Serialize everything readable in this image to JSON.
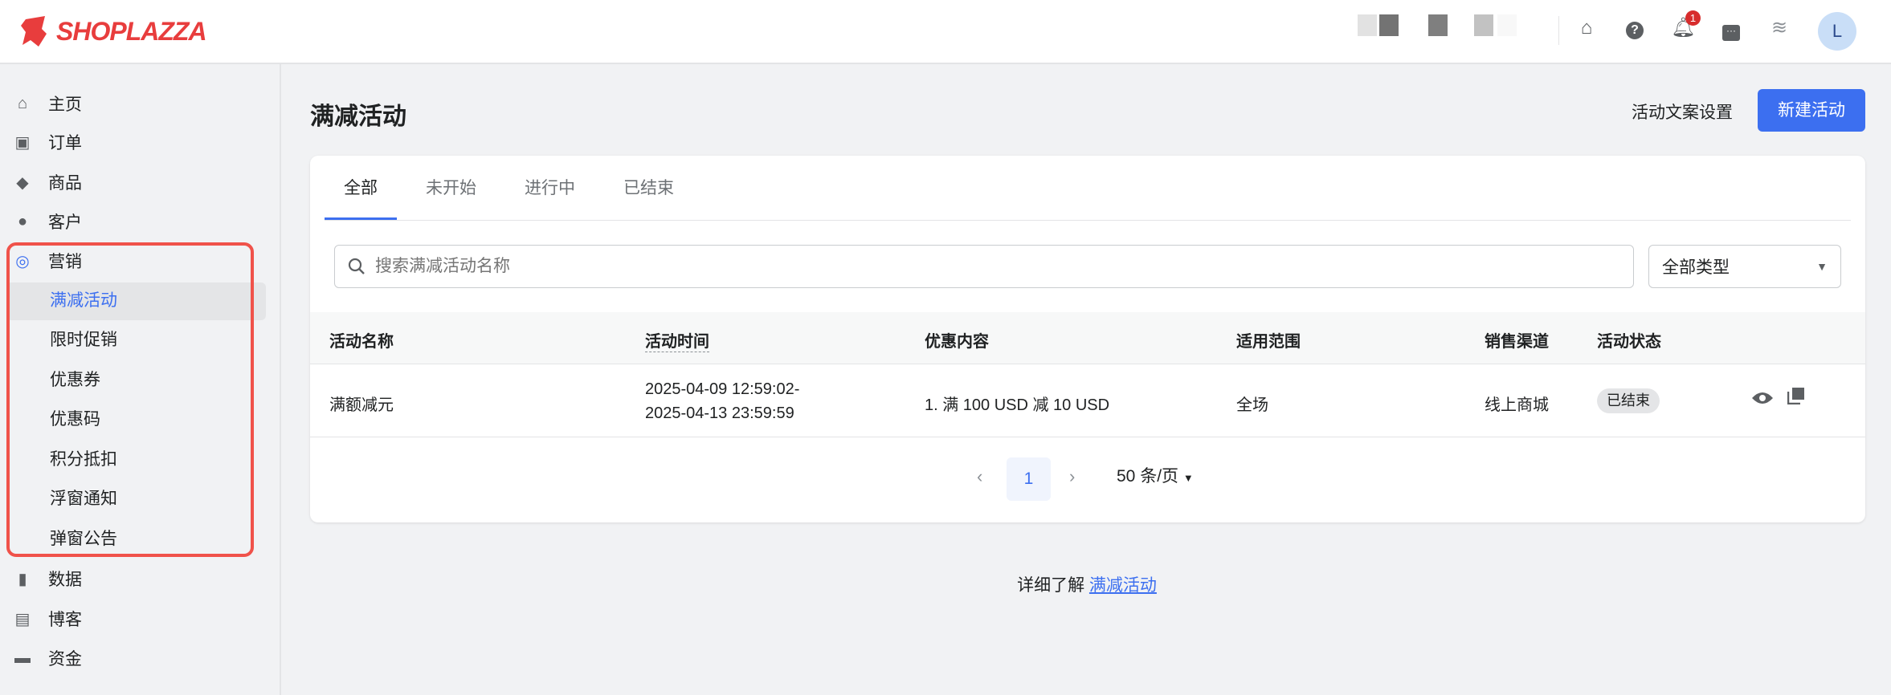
{
  "brand": {
    "name": "SHOPLAZZA",
    "color": "#e83d3d"
  },
  "topbar": {
    "notification_count": "1",
    "avatar_initial": "L",
    "icons": [
      "store-icon",
      "help-icon",
      "bell-icon",
      "chat-icon",
      "wifi-icon"
    ]
  },
  "sidebar": {
    "items": [
      {
        "label": "主页",
        "icon": "home-icon"
      },
      {
        "label": "订单",
        "icon": "inbox-icon"
      },
      {
        "label": "商品",
        "icon": "tag-icon"
      },
      {
        "label": "客户",
        "icon": "person-icon"
      },
      {
        "label": "营销",
        "icon": "marketing-icon"
      },
      {
        "label": "数据",
        "icon": "chart-icon"
      },
      {
        "label": "博客",
        "icon": "blog-icon"
      },
      {
        "label": "资金",
        "icon": "wallet-icon"
      }
    ],
    "marketing_sub": [
      "满减活动",
      "限时促销",
      "优惠券",
      "优惠码",
      "积分抵扣",
      "浮窗通知",
      "弹窗公告"
    ]
  },
  "page": {
    "title": "满减活动",
    "copy_settings": "活动文案设置",
    "new_button": "新建活动"
  },
  "tabs": [
    "全部",
    "未开始",
    "进行中",
    "已结束"
  ],
  "filters": {
    "search_placeholder": "搜索满减活动名称",
    "type_select": "全部类型"
  },
  "table": {
    "headers": [
      "活动名称",
      "活动时间",
      "优惠内容",
      "适用范围",
      "销售渠道",
      "活动状态"
    ],
    "rows": [
      {
        "name": "满额减元",
        "time_start": "2025-04-09 12:59:02-",
        "time_end": "2025-04-13 23:59:59",
        "discount": "1. 满 100 USD 减 10 USD",
        "scope": "全场",
        "channel": "线上商城",
        "status": "已结束"
      }
    ]
  },
  "pagination": {
    "current": "1",
    "page_size": "50 条/页"
  },
  "footer": {
    "text": "详细了解",
    "link": "满减活动"
  },
  "colors": {
    "accent": "#3c6ff0",
    "highlight": "#f0524a"
  }
}
